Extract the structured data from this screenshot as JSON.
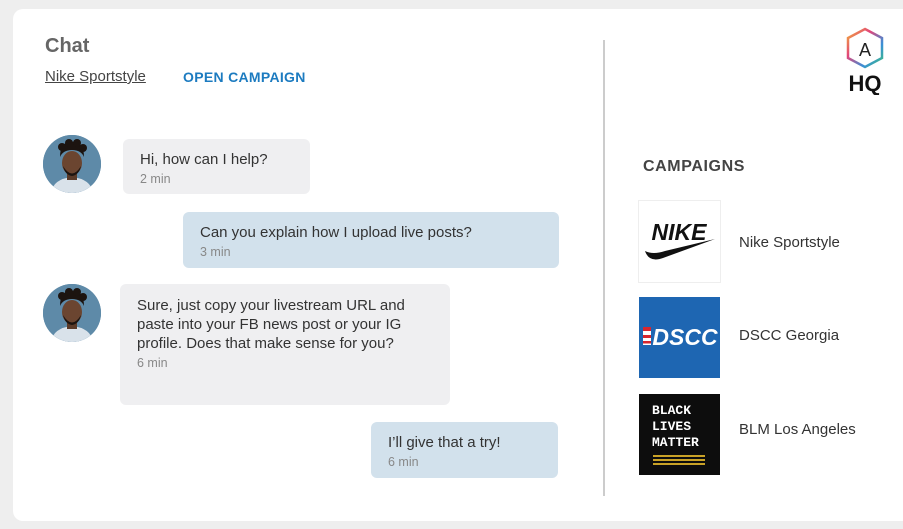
{
  "chat": {
    "title": "Chat",
    "campaign_link": "Nike Sportstyle",
    "open_campaign": "OPEN CAMPAIGN"
  },
  "messages": [
    {
      "from": "agent",
      "text": "Hi, how can I help?",
      "time": "2 min"
    },
    {
      "from": "user",
      "text": "Can you explain how I upload live posts?",
      "time": "3 min"
    },
    {
      "from": "agent",
      "text": "Sure, just copy your livestream URL and paste into your FB news post or your IG profile. Does that make sense for you?",
      "time": "6 min"
    },
    {
      "from": "user",
      "text": "I’ll give that a try!",
      "time": "6 min"
    }
  ],
  "brand": {
    "hex_letter": "A",
    "name": "HQ"
  },
  "campaigns": {
    "title": "CAMPAIGNS",
    "items": [
      {
        "name": "Nike Sportstyle",
        "logo_text": "NIKE",
        "icon": "nike-logo"
      },
      {
        "name": "DSCC Georgia",
        "logo_text": "DSCC",
        "icon": "dscc-logo"
      },
      {
        "name": "BLM Los Angeles",
        "logo_text": [
          "BLACK",
          "LIVES",
          "MATTER"
        ],
        "icon": "blm-logo"
      }
    ]
  },
  "colors": {
    "accent": "#1c7bc0",
    "incoming_bubble": "#efeff1",
    "outgoing_bubble": "#d2e1ec",
    "dscc_blue": "#1e66b2",
    "blm_gold": "#c9a227"
  }
}
